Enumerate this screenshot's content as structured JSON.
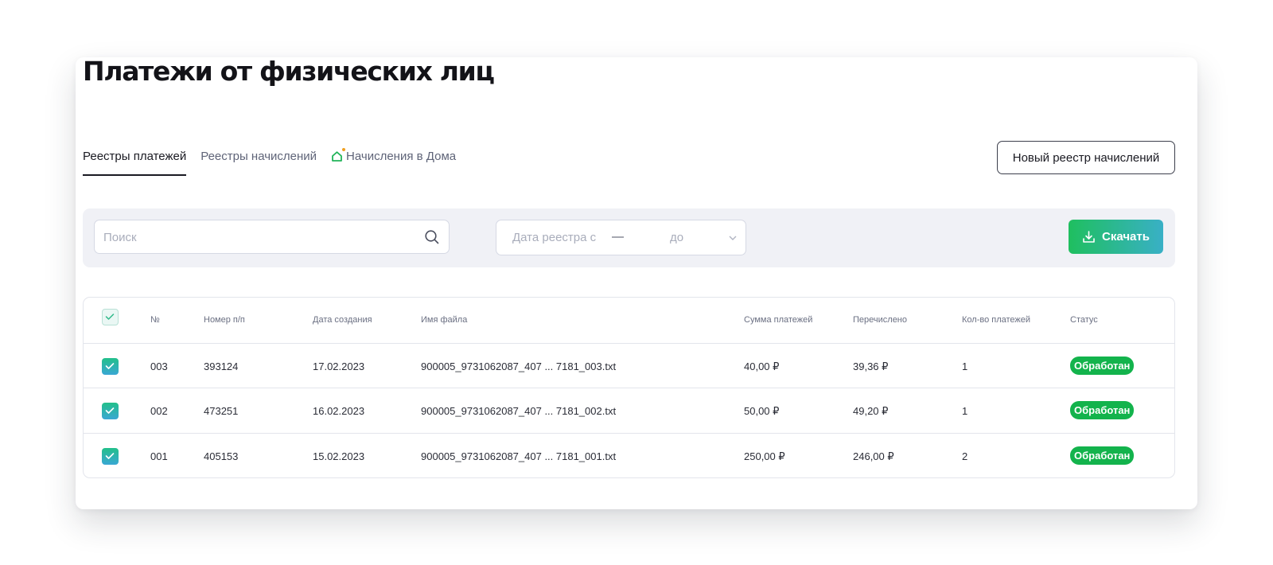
{
  "page": {
    "title": "Платежи от физических лиц"
  },
  "tabs": [
    {
      "label": "Реестры платежей",
      "active": true
    },
    {
      "label": "Реестры начислений",
      "active": false
    },
    {
      "label": "Начисления в Дома",
      "active": false,
      "icon": "home-icon"
    }
  ],
  "actions": {
    "new_registry_label": "Новый реестр начислений"
  },
  "filters": {
    "search_placeholder": "Поиск",
    "date_from_placeholder": "Дата реестра с",
    "date_dash": "—",
    "date_to_placeholder": "до",
    "download_label": "Скачать"
  },
  "table": {
    "columns": [
      "№",
      "Номер п/п",
      "Дата создания",
      "Имя файла",
      "Сумма платежей",
      "Перечислено",
      "Кол-во платежей",
      "Статус"
    ],
    "rows": [
      {
        "no": "003",
        "num": "393124",
        "date": "17.02.2023",
        "file": "900005_9731062087_407 ... 7181_003.txt",
        "sum": "40,00 ₽",
        "sent": "39,36 ₽",
        "count": "1",
        "status": "Обработан",
        "checked": true
      },
      {
        "no": "002",
        "num": "473251",
        "date": "16.02.2023",
        "file": "900005_9731062087_407 ... 7181_002.txt",
        "sum": "50,00 ₽",
        "sent": "49,20 ₽",
        "count": "1",
        "status": "Обработан",
        "checked": true
      },
      {
        "no": "001",
        "num": "405153",
        "date": "15.02.2023",
        "file": "900005_9731062087_407 ... 7181_001.txt",
        "sum": "250,00 ₽",
        "sent": "246,00 ₽",
        "count": "2",
        "status": "Обработан",
        "checked": true
      }
    ]
  },
  "colors": {
    "accent_green": "#13b34c",
    "download_gradient_start": "#1fbf5f",
    "download_gradient_end": "#39b0c6",
    "filter_bar_bg": "#f0f1f6"
  }
}
